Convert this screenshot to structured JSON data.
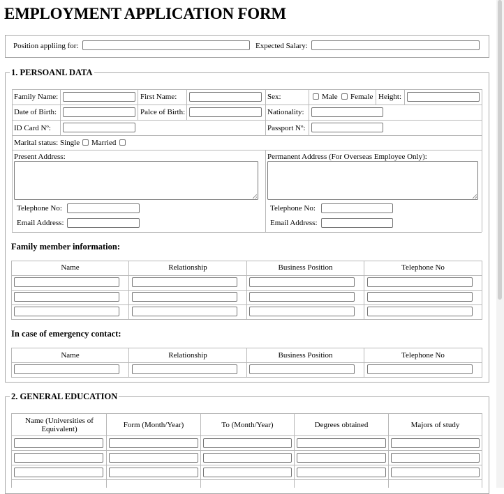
{
  "page": {
    "title": "EMPLOYMENT APPLICATION FORM"
  },
  "position": {
    "position_label": "Position appliing for:",
    "salary_label": "Expected Salary:"
  },
  "personal": {
    "legend": "1. PERSOANL DATA",
    "family_name": "Family Name:",
    "first_name": "First Name:",
    "sex": "Sex:",
    "male": "Male",
    "female": "Female",
    "height": "Height:",
    "dob": "Date of Birth:",
    "pob": "Palce of Birth:",
    "nationality": "Nationality:",
    "id_card": "ID Card Nº:",
    "passport": "Passport Nº:",
    "marital": "Marital status: Single",
    "married": "Married",
    "present_address": "Present Address:",
    "permanent_address": "Permanent Address (For Overseas Employee Only):",
    "telephone": "Telephone No:",
    "email": "Email Address:"
  },
  "family": {
    "heading": "Family member information:",
    "columns": [
      "Name",
      "Relationship",
      "Business Position",
      "Telephone No"
    ]
  },
  "emergency": {
    "heading": "In case of emergency contact:",
    "columns": [
      "Name",
      "Relationship",
      "Business Position",
      "Telephone No"
    ]
  },
  "education": {
    "legend": "2. GENERAL EDUCATION",
    "columns": [
      "Name (Universities of Equivalent)",
      "Form (Month/Year)",
      "To (Month/Year)",
      "Degrees obtained",
      "Majors of study"
    ]
  }
}
